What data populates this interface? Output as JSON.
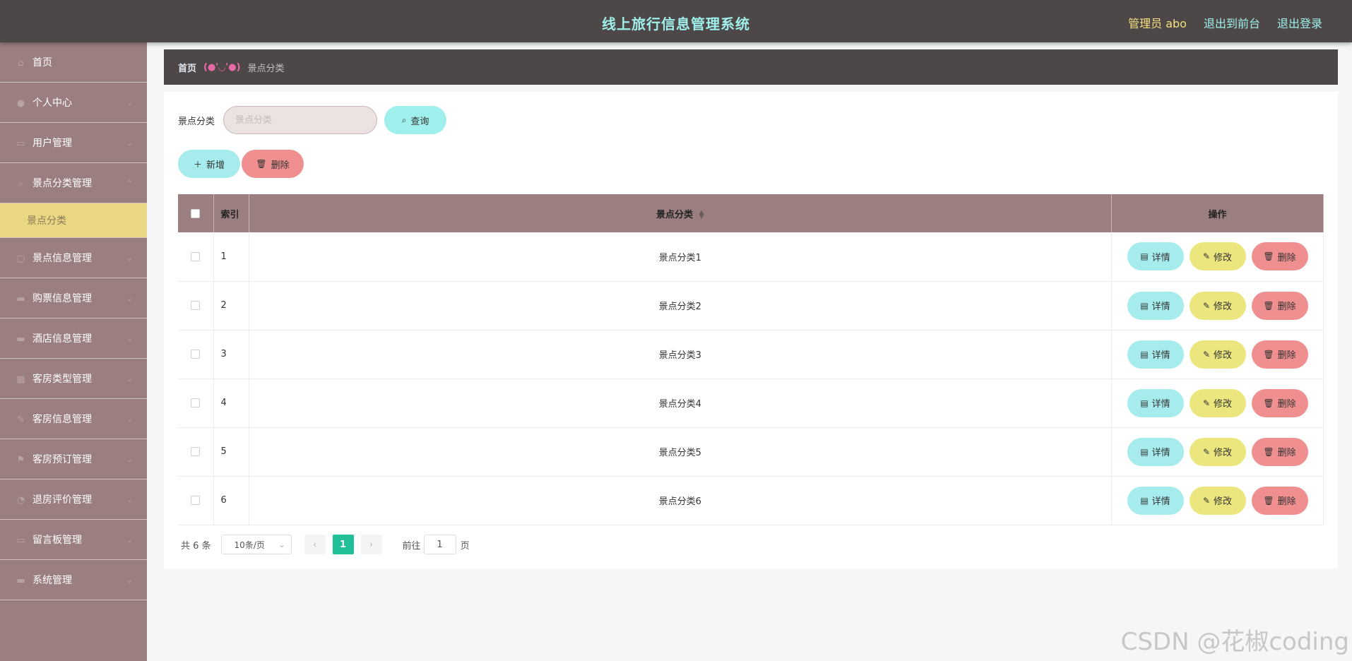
{
  "header": {
    "title": "线上旅行信息管理系统",
    "admin": "管理员 abo",
    "to_front": "退出到前台",
    "logout": "退出登录"
  },
  "sidebar": {
    "items": [
      {
        "label": "首页",
        "icon": "home-icon"
      },
      {
        "label": "个人中心",
        "icon": "user-icon"
      },
      {
        "label": "用户管理",
        "icon": "users-icon"
      },
      {
        "label": "景点分类管理",
        "icon": "category-icon",
        "expanded": true
      },
      {
        "label": "景点信息管理",
        "icon": "doc-icon"
      },
      {
        "label": "购票信息管理",
        "icon": "ticket-icon"
      },
      {
        "label": "酒店信息管理",
        "icon": "hotel-icon"
      },
      {
        "label": "客房类型管理",
        "icon": "grid-icon"
      },
      {
        "label": "客房信息管理",
        "icon": "room-icon"
      },
      {
        "label": "客房预订管理",
        "icon": "flag-icon"
      },
      {
        "label": "退房评价管理",
        "icon": "review-icon"
      },
      {
        "label": "留言板管理",
        "icon": "message-icon"
      },
      {
        "label": "系统管理",
        "icon": "system-icon"
      }
    ],
    "sub_item": "景点分类"
  },
  "breadcrumb": {
    "home": "首页",
    "separator": "(●'◡'●)",
    "current": "景点分类"
  },
  "search": {
    "label": "景点分类",
    "placeholder": "景点分类",
    "query_button": "查询"
  },
  "actions": {
    "add": "新增",
    "delete": "删除"
  },
  "table": {
    "headers": {
      "index": "索引",
      "category": "景点分类",
      "operations": "操作"
    },
    "rows": [
      {
        "index": "1",
        "category": "景点分类1"
      },
      {
        "index": "2",
        "category": "景点分类2"
      },
      {
        "index": "3",
        "category": "景点分类3"
      },
      {
        "index": "4",
        "category": "景点分类4"
      },
      {
        "index": "5",
        "category": "景点分类5"
      },
      {
        "index": "6",
        "category": "景点分类6"
      }
    ],
    "ops": {
      "detail": "详情",
      "edit": "修改",
      "delete": "删除"
    }
  },
  "pagination": {
    "total": "共 6 条",
    "page_size": "10条/页",
    "current_page": "1",
    "goto_label": "前往",
    "goto_value": "1",
    "goto_suffix": "页"
  },
  "watermark": "CSDN @花椒coding",
  "colors": {
    "header_bg": "#4e4747",
    "sidebar_bg": "#9b7f80",
    "active_sub": "#e9d784",
    "accent_cyan": "#9ff0ec",
    "danger": "#ef8f90",
    "edit": "#ebe67d",
    "pager_active": "#21c098"
  }
}
